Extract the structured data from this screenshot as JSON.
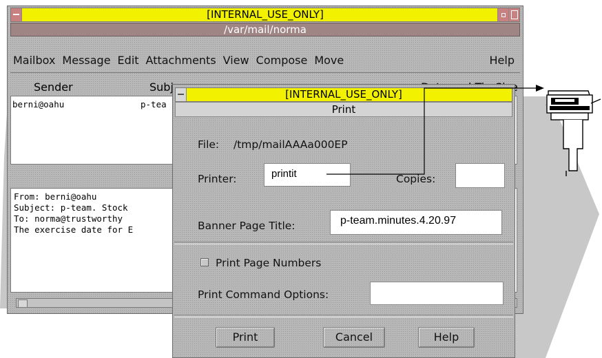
{
  "mail_window": {
    "title": "[INTERNAL_USE_ONLY]",
    "path": "/var/mail/norma",
    "menu": [
      "Mailbox",
      "Message",
      "Edit",
      "Attachments",
      "View",
      "Compose",
      "Move",
      "Help"
    ],
    "columns": {
      "sender": "Sender",
      "subject": "Subj",
      "datetime": "Date and Time",
      "size": "Size"
    },
    "messages": [
      {
        "sender": "berni@oahu",
        "subject": "p-tea"
      }
    ],
    "preview_lines": [
      "From: berni@oahu",
      "Subject: p-team. Stock",
      "To: norma@trustworthy",
      "The exercise date for E"
    ]
  },
  "print_dialog": {
    "title": "[INTERNAL_USE_ONLY]",
    "subtitle": "Print",
    "file_label": "File:",
    "file_value": "/tmp/mailAAAa000EP",
    "printer_label": "Printer:",
    "printer_value": "printit",
    "copies_label": "Copies:",
    "copies_value": "",
    "banner_label": "Banner Page Title:",
    "banner_value": "p-team.minutes.4.20.97",
    "page_numbers_label": "Print Page Numbers",
    "page_numbers_checked": false,
    "options_label": "Print Command Options:",
    "options_value": "",
    "buttons": {
      "print": "Print",
      "cancel": "Cancel",
      "help": "Help"
    }
  },
  "colors": {
    "label_bar": "#f2f200",
    "path_bar": "#a08585",
    "window_bg": "#b8b8b8"
  }
}
